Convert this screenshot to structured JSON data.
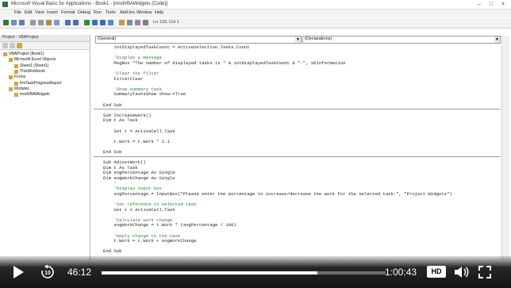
{
  "window": {
    "title": "Microsoft Visual Basic for Applications - Book1 - [modVBAWidgets (Code)]",
    "controls": [
      "–",
      "□",
      "×"
    ]
  },
  "menu": [
    "File",
    "Edit",
    "View",
    "Insert",
    "Format",
    "Debug",
    "Run",
    "Tools",
    "Add-Ins",
    "Window",
    "Help"
  ],
  "toolbar": {
    "position": "Ln 133, Col 1"
  },
  "project": {
    "title": "Project - VBAProject",
    "nodes": [
      {
        "label": "VBAProject (Book1)",
        "indent": 0
      },
      {
        "label": "Microsoft Excel Objects",
        "indent": 1
      },
      {
        "label": "Sheet1 (Sheet1)",
        "indent": 2
      },
      {
        "label": "ThisWorkbook",
        "indent": 2
      },
      {
        "label": "Forms",
        "indent": 1
      },
      {
        "label": "frmTaskProgressReport",
        "indent": 2
      },
      {
        "label": "Modules",
        "indent": 1
      },
      {
        "label": "modVBAWidgets",
        "indent": 2
      }
    ]
  },
  "code": {
    "object_combo": "(General)",
    "proc_combo": "(Declarations)",
    "lines": [
      {
        "t": "    intDisplayedTaskCount = ActiveSelection.Tasks.Count",
        "c": false
      },
      {
        "t": "",
        "c": false
      },
      {
        "t": "    'Display a message",
        "c": true
      },
      {
        "t": "    MsgBox \"The number of displayed tasks is \" & intDisplayedTaskCount & \".\", vbInformation",
        "c": false
      },
      {
        "t": "",
        "c": false
      },
      {
        "t": "    'Clear the filter",
        "c": true
      },
      {
        "t": "    FilterClear",
        "c": false
      },
      {
        "t": "",
        "c": false
      },
      {
        "t": "    'Show summary task",
        "c": true
      },
      {
        "t": "    SummaryTasksShow Show:=True",
        "c": false
      },
      {
        "t": "",
        "c": false
      },
      {
        "t": "End Sub",
        "c": false
      },
      {
        "t": "",
        "c": false
      },
      {
        "t": "Sub IncreaseWork()",
        "c": false
      },
      {
        "t": "Dim t As Task",
        "c": false
      },
      {
        "t": "",
        "c": false
      },
      {
        "t": "    Set t = ActiveCell.Task",
        "c": false
      },
      {
        "t": "",
        "c": false
      },
      {
        "t": "    t.Work = t.Work * 1.1",
        "c": false
      },
      {
        "t": "",
        "c": false
      },
      {
        "t": "End Sub",
        "c": false
      },
      {
        "t": "",
        "c": false
      },
      {
        "t": "Sub AdjustWork()",
        "c": false
      },
      {
        "t": "Dim t As Task",
        "c": false
      },
      {
        "t": "Dim sngPercentage As Single",
        "c": false
      },
      {
        "t": "Dim sngWorkChange As Single",
        "c": false
      },
      {
        "t": "    '",
        "c": false
      },
      {
        "t": "    'Display input box",
        "c": true
      },
      {
        "t": "    sngPercentage = InputBox(\"Please enter the percentage to increase/decrease the work for the selected task:\", \"Project Widgets\")",
        "c": false
      },
      {
        "t": "",
        "c": false
      },
      {
        "t": "    'Set reference to selected task",
        "c": true
      },
      {
        "t": "    Set t = ActiveCell.Task",
        "c": false
      },
      {
        "t": "",
        "c": false
      },
      {
        "t": "    'Calculate work change",
        "c": true
      },
      {
        "t": "    sngWorkChange = t.Work * (sngPercentage / 100)",
        "c": false
      },
      {
        "t": "",
        "c": false
      },
      {
        "t": "    'Apply change to the task",
        "c": true
      },
      {
        "t": "    t.Work = t.Work + sngWorkChange",
        "c": false
      },
      {
        "t": "",
        "c": false
      },
      {
        "t": "End Sub",
        "c": false
      }
    ]
  },
  "player": {
    "current_time": "46:12",
    "total_time": "1:00:43",
    "progress": 0.761,
    "rewind_seconds": "10",
    "quality_badge": "HD",
    "play_icon": "play-icon",
    "rewind_icon": "rewind-10-icon",
    "volume_icon": "volume-icon",
    "fullscreen_icon": "fullscreen-icon"
  }
}
